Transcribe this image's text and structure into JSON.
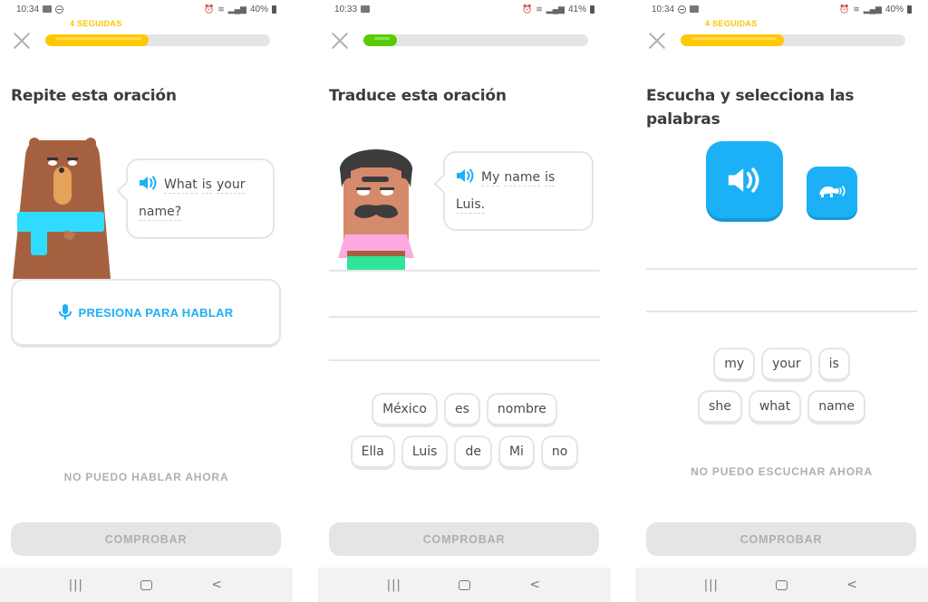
{
  "colors": {
    "streak": "#ffc200",
    "progress_yellow": "#ffc800",
    "progress_green": "#58cc02",
    "accent_blue": "#1cb0f6",
    "disabled_gray": "#afafaf",
    "border_gray": "#e5e5e5"
  },
  "screens": [
    {
      "status": {
        "time": "10:34",
        "battery": "40%"
      },
      "streak_label": "4 SEGUIDAS",
      "progress": 0.46,
      "title": "Repite esta oración",
      "bubble_words": [
        "What",
        "is",
        "your",
        "name?"
      ],
      "speak_button": "PRESIONA PARA HABLAR",
      "skip_link": "NO PUEDO HABLAR AHORA",
      "check_button": "COMPROBAR"
    },
    {
      "status": {
        "time": "10:33",
        "battery": "41%"
      },
      "streak_label": "",
      "progress": 0.15,
      "title": "Traduce esta oración",
      "bubble_words": [
        "My",
        "name",
        "is",
        "Luis."
      ],
      "word_bank_rows": [
        [
          "México",
          "es",
          "nombre"
        ],
        [
          "Ella",
          "Luis",
          "de",
          "Mi",
          "no"
        ]
      ],
      "check_button": "COMPROBAR"
    },
    {
      "status": {
        "time": "10:34",
        "battery": "40%"
      },
      "streak_label": "4 SEGUIDAS",
      "progress": 0.46,
      "title": "Escucha y selecciona las palabras",
      "word_bank_rows": [
        [
          "my",
          "your",
          "is"
        ],
        [
          "she",
          "what",
          "name"
        ]
      ],
      "skip_link": "NO PUEDO ESCUCHAR AHORA",
      "check_button": "COMPROBAR"
    }
  ]
}
